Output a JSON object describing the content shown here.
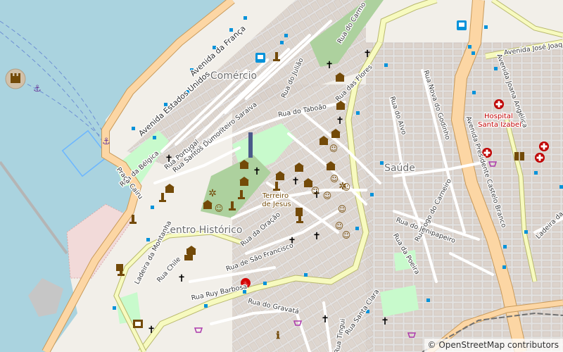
{
  "map": {
    "attribution": "© OpenStreetMap contributors",
    "colors": {
      "water": "#aad3df",
      "land": "#f2efe9",
      "residential": "#e0dfdf",
      "building": "#d9d0c9",
      "park": "#c8facc",
      "wood": "#add19e",
      "primary_road": "#fcd6a4",
      "primary_casing": "#c99a5a",
      "secondary_road": "#f7fabf",
      "secondary_casing": "#b9b96e",
      "pier": "#c6c6c6",
      "poi_brown": "#734a08",
      "poi_blue": "#0092da",
      "hospital_red": "#bf0000",
      "religious": "#000000"
    },
    "districts": [
      {
        "name": "Comércio"
      },
      {
        "name": "Centro Histórico"
      },
      {
        "name": "Saúde"
      }
    ],
    "places": [
      {
        "name": "Terreiro de Jesus"
      },
      {
        "name": "Hospital Santa Izabel"
      }
    ],
    "streets": [
      "Avenida da França",
      "Avenida Estados Unidos",
      "Rua Conselheiro Saraiva",
      "Rua Santos Dumont",
      "Rua Portugal",
      "Rua da Bélgica",
      "Praça Cairu",
      "Rua do Julião",
      "Rua do Taboão",
      "Rua das Flores",
      "Rua do Carmo",
      "Rua do Alvo",
      "Rua Nova do Godinho",
      "Avenida José Joaq",
      "Avenida Joana Angélica",
      "Avenida Presidente Castelo Branco",
      "Rua Jogo do Carneiro",
      "Rua do Jenipapeiro",
      "Rua da Poeira",
      "Ladeira da Montanha",
      "Rua Chile",
      "Rua da Oração",
      "Rua de São Francisco",
      "Rua Ruy Barbosa",
      "Rua do Gravatá",
      "Rua Santa Clara",
      "Ladeira da",
      "Rua Tingui"
    ],
    "icons": {
      "fort": "fort-icon",
      "anchor": "anchor-icon",
      "church": "church-icon",
      "museum": "museum-icon",
      "theatre": "theatre-icon",
      "monument": "monument-icon",
      "bus": "bus-stop-icon",
      "hospital": "hospital-icon",
      "shop": "shop-icon",
      "library": "library-icon",
      "cinema": "cinema-icon",
      "fire": "fire-station-icon",
      "info": "information-icon",
      "viewpoint": "viewpoint-icon"
    }
  }
}
